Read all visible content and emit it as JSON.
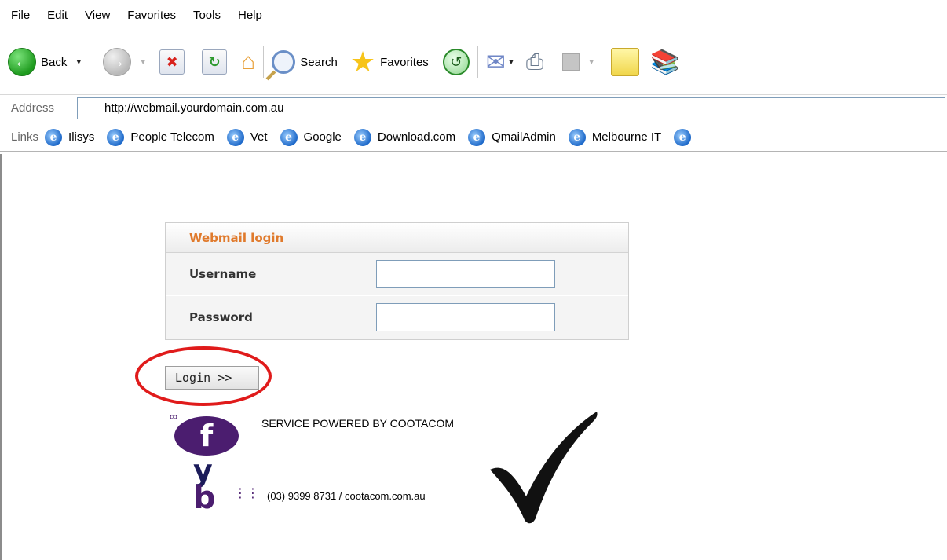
{
  "menu": {
    "items": [
      "File",
      "Edit",
      "View",
      "Favorites",
      "Tools",
      "Help"
    ]
  },
  "toolbar": {
    "back_label": "Back",
    "search_label": "Search",
    "favorites_label": "Favorites",
    "icons": [
      "back-icon",
      "forward-icon",
      "stop-icon",
      "refresh-icon",
      "home-icon",
      "search-icon",
      "favorites-star-icon",
      "history-icon",
      "mail-icon",
      "print-icon",
      "edit-icon",
      "notes-icon",
      "research-icon"
    ]
  },
  "address": {
    "label": "Address",
    "url": "http://webmail.yourdomain.com.au"
  },
  "links": {
    "label": "Links",
    "items": [
      "Ilisys",
      "People Telecom",
      "Vet",
      "Google",
      "Download.com",
      "QmailAdmin",
      "Melbourne IT"
    ]
  },
  "login": {
    "heading": "Webmail login",
    "username_label": "Username",
    "password_label": "Password",
    "username_value": "",
    "password_value": "",
    "button_label": "Login >>"
  },
  "footer": {
    "powered": "SERVICE POWERED BY COOTACOM",
    "contact": "(03) 9399 8731 / cootacom.com.au"
  },
  "colors": {
    "heading_accent": "#e07a2c",
    "annotation_circle": "#e01b1b",
    "logo_purple": "#4b1d6f"
  }
}
